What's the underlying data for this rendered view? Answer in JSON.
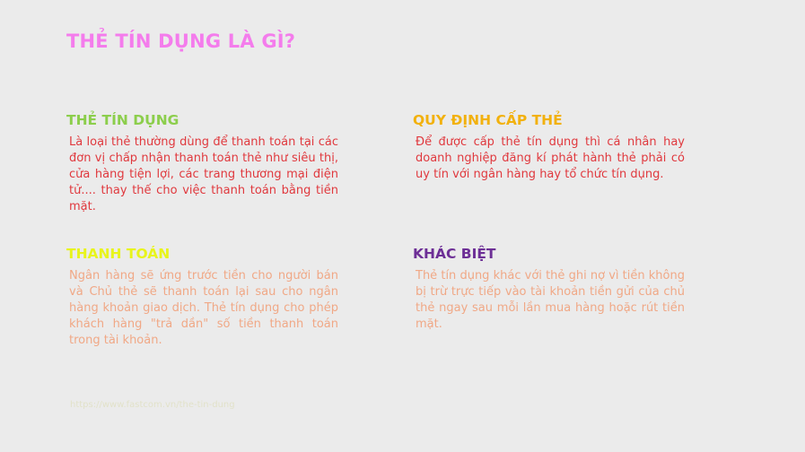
{
  "slide": {
    "title": "THẺ TÍN DỤNG LÀ GÌ?",
    "sections": [
      {
        "heading": "THẺ TÍN DỤNG",
        "body": "Là loại thẻ thường dùng để thanh toán tại các đơn vị chấp nhận thanh toán thẻ như siêu thị, cửa hàng tiện lợi, các trang thương mại điện tử.... thay thế cho việc thanh toán bằng tiền mặt."
      },
      {
        "heading": "QUY ĐỊNH CẤP THẺ",
        "body": "Để được cấp thẻ tín dụng thì cá nhân hay doanh nghiệp đăng kí phát hành thẻ phải có uy tín với ngân hàng hay tổ chức tín dụng."
      },
      {
        "heading": "THANH TOÁN",
        "body": "Ngân hàng sẽ ứng trước tiền cho người bán và Chủ thẻ sẽ thanh toán lại sau cho ngân hàng khoản giao dịch. Thẻ tín dụng cho phép khách hàng \"trả dần\" số tiền thanh toán trong tài khoản."
      },
      {
        "heading": "KHÁC BIỆT",
        "body": "Thẻ tín dụng khác với thẻ ghi nợ vì tiền không bị trừ trực tiếp vào tài khoản tiền gửi của chủ thẻ ngay sau mỗi lần mua hàng hoặc rút tiền mặt."
      }
    ],
    "footer": "https://www.fastcom.vn/the-tin-dung"
  },
  "colors": {
    "background": "#ebebeb",
    "title": "#f47cec",
    "heading_1": "#8cce4c",
    "body_1": "#e0393e",
    "heading_2": "#f2b10d",
    "body_2": "#e0393e",
    "heading_3": "#e8f41c",
    "body_3": "#f0a886",
    "heading_4": "#6d2f96",
    "body_4": "#f0a886",
    "footer": "#d9d9a8"
  }
}
